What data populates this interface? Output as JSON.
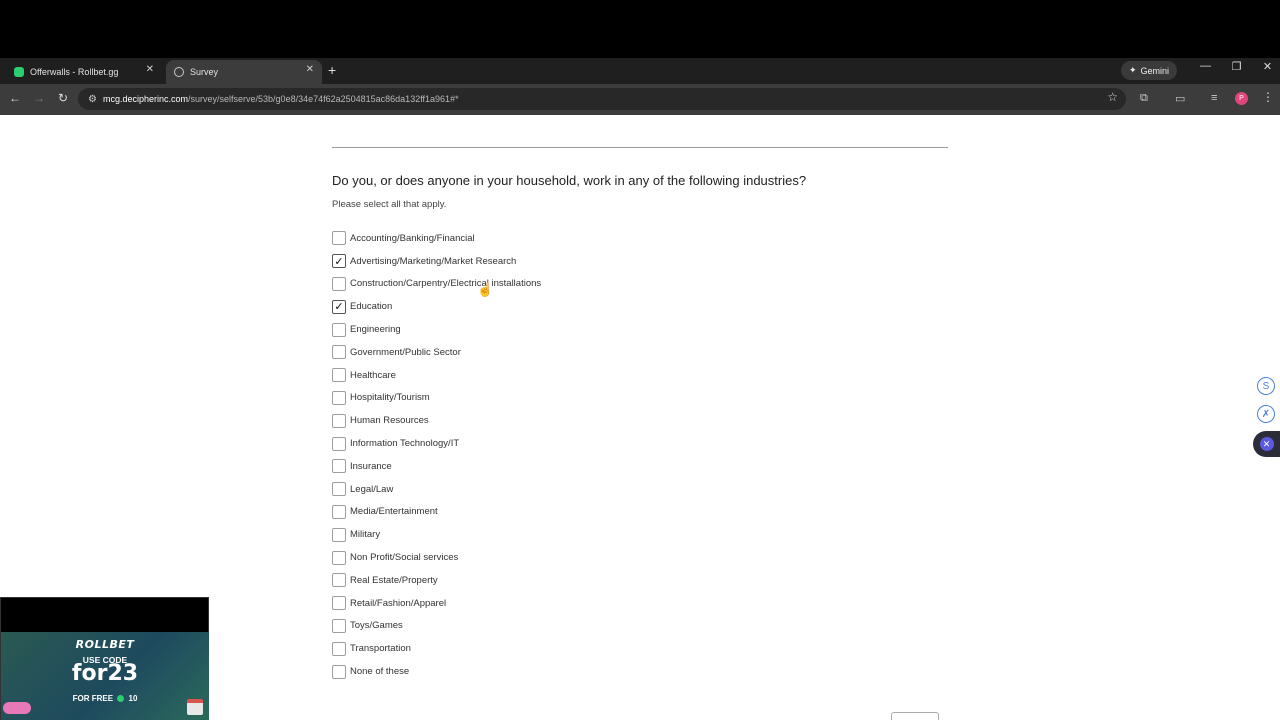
{
  "browser": {
    "tabs": [
      {
        "title": "Offerwalls - Rollbet.gg",
        "active": false
      },
      {
        "title": "Survey",
        "active": true
      }
    ],
    "new_tab_label": "+",
    "gemini_label": "Gemini",
    "url_host": "mcg.decipherinc.com",
    "url_path": "/survey/selfserve/53b/g0e8/34e74f62a2504815ac86da132ff1a961#*",
    "profile_initial": "P"
  },
  "survey": {
    "question": "Do you, or does anyone in your household, work in any of the following industries?",
    "instruction": "Please select all that apply.",
    "options": [
      {
        "label": "Accounting/Banking/Financial",
        "checked": false
      },
      {
        "label": "Advertising/Marketing/Market Research",
        "checked": true
      },
      {
        "label": "Construction/Carpentry/Electrical installations",
        "checked": false
      },
      {
        "label": "Education",
        "checked": true
      },
      {
        "label": "Engineering",
        "checked": false
      },
      {
        "label": "Government/Public Sector",
        "checked": false
      },
      {
        "label": "Healthcare",
        "checked": false
      },
      {
        "label": "Hospitality/Tourism",
        "checked": false
      },
      {
        "label": "Human Resources",
        "checked": false
      },
      {
        "label": "Information Technology/IT",
        "checked": false
      },
      {
        "label": "Insurance",
        "checked": false
      },
      {
        "label": "Legal/Law",
        "checked": false
      },
      {
        "label": "Media/Entertainment",
        "checked": false
      },
      {
        "label": "Military",
        "checked": false
      },
      {
        "label": "Non Profit/Social services",
        "checked": false
      },
      {
        "label": "Real Estate/Property",
        "checked": false
      },
      {
        "label": "Retail/Fashion/Apparel",
        "checked": false
      },
      {
        "label": "Toys/Games",
        "checked": false
      },
      {
        "label": "Transportation",
        "checked": false
      },
      {
        "label": "None of these",
        "checked": false
      }
    ]
  },
  "side_icons": [
    "S",
    "✗",
    "✕"
  ],
  "promo": {
    "brand": "ROLLBET",
    "use_code_label": "USE CODE",
    "code": "for23",
    "free_text_before": "FOR FREE",
    "free_text_after": "10"
  },
  "colors": {
    "accent": "#4a7fd8",
    "rollbet_green": "#2ecc71"
  }
}
